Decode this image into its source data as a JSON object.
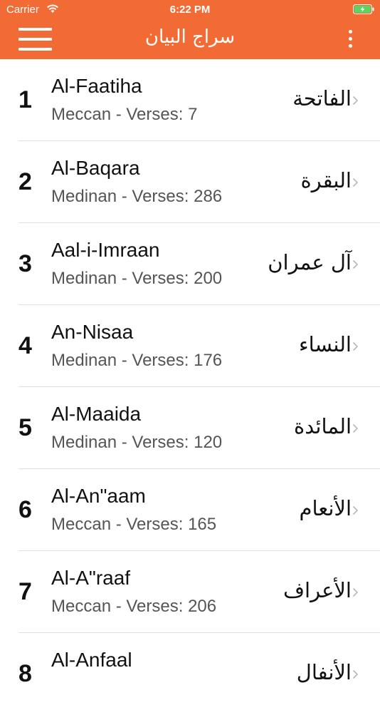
{
  "status": {
    "carrier": "Carrier",
    "time": "6:22 PM"
  },
  "nav": {
    "title": "سراج البيان"
  },
  "surahs": [
    {
      "number": "1",
      "name": "Al-Faatiha",
      "subtitle": "Meccan - Verses: 7",
      "arabic": "الفاتحة"
    },
    {
      "number": "2",
      "name": "Al-Baqara",
      "subtitle": "Medinan - Verses: 286",
      "arabic": "البقرة"
    },
    {
      "number": "3",
      "name": "Aal-i-Imraan",
      "subtitle": "Medinan - Verses: 200",
      "arabic": "آل عمران"
    },
    {
      "number": "4",
      "name": "An-Nisaa",
      "subtitle": "Medinan - Verses: 176",
      "arabic": "النساء"
    },
    {
      "number": "5",
      "name": "Al-Maaida",
      "subtitle": "Medinan - Verses: 120",
      "arabic": "المائدة"
    },
    {
      "number": "6",
      "name": "Al-An\"aam",
      "subtitle": "Meccan - Verses: 165",
      "arabic": "الأنعام"
    },
    {
      "number": "7",
      "name": "Al-A\"raaf",
      "subtitle": "Meccan - Verses: 206",
      "arabic": "الأعراف"
    },
    {
      "number": "8",
      "name": "Al-Anfaal",
      "subtitle": "",
      "arabic": "الأنفال"
    }
  ],
  "colors": {
    "header": "#F26B35",
    "text": "#111111",
    "subtext": "#555555",
    "separator": "#e0e0e0",
    "battery": "#5FD35F"
  },
  "icons": [
    "wifi-icon",
    "battery-icon",
    "menu-icon",
    "more-vertical-icon",
    "chevron-right-icon"
  ]
}
